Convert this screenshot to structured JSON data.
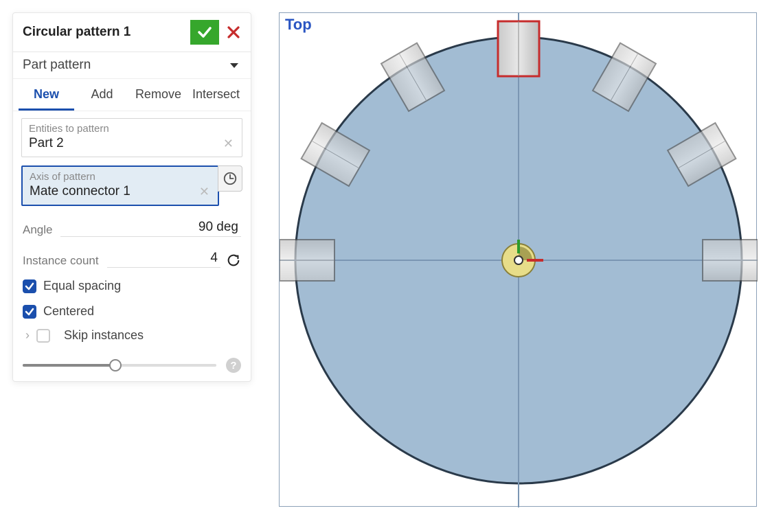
{
  "panel": {
    "title": "Circular pattern 1",
    "dropdown": "Part pattern",
    "tabs": [
      "New",
      "Add",
      "Remove",
      "Intersect"
    ],
    "active_tab": 0,
    "entities": {
      "label": "Entities to pattern",
      "value": "Part 2"
    },
    "axis": {
      "label": "Axis of pattern",
      "value": "Mate connector 1"
    },
    "angle": {
      "label": "Angle",
      "value": "90 deg"
    },
    "instance_count": {
      "label": "Instance count",
      "value": "4"
    },
    "equal_spacing": "Equal spacing",
    "centered": "Centered",
    "skip_instances": "Skip instances"
  },
  "viewport": {
    "label": "Top"
  }
}
